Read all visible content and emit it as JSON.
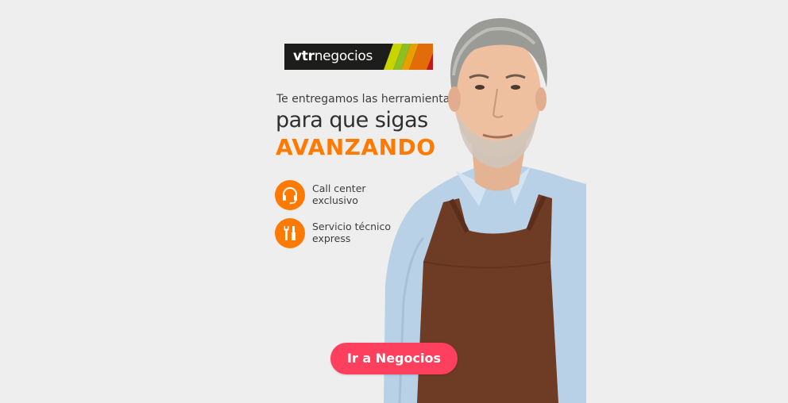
{
  "logo": {
    "brand_bold": "vtr",
    "brand_rest": "negocios",
    "stripe_colors": [
      "#c8d400",
      "#8cbf26",
      "#e6a000",
      "#e36c0a",
      "#c4161c"
    ]
  },
  "headline": {
    "line1": "Te entregamos las herramientas",
    "line2": "para que sigas",
    "line3": "AVANZANDO"
  },
  "features": [
    {
      "icon": "headset-icon",
      "line1": "Call center",
      "line2": "exclusivo"
    },
    {
      "icon": "tools-icon",
      "line1": "Servicio técnico",
      "line2": "express"
    }
  ],
  "cta": {
    "label": "Ir a Negocios"
  },
  "colors": {
    "background": "#eeeeee",
    "accent_orange": "#ff7a00",
    "cta_pink": "#ff3f5e",
    "logo_bg": "#1d1d1b"
  }
}
